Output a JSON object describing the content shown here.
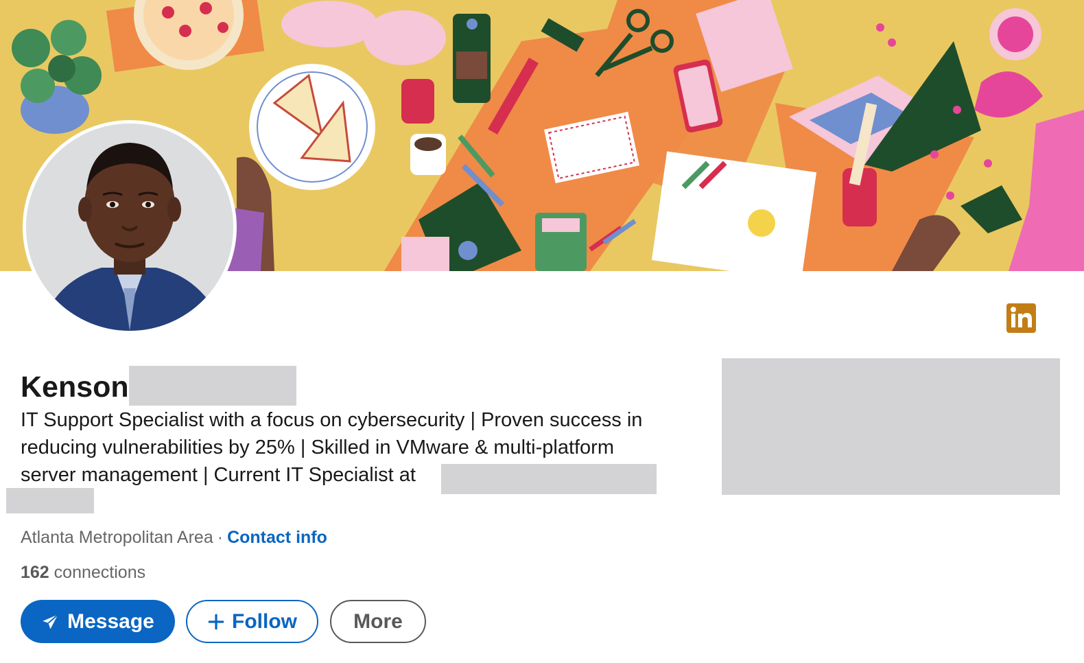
{
  "profile": {
    "name_visible": "Kenson",
    "headline_line1": "IT Support Specialist with a focus on cybersecurity | Proven success in",
    "headline_line2": "reducing vulnerabilities by 25% | Skilled in VMware & multi-platform",
    "headline_line3": "server management | Current IT Specialist at",
    "location": "Atlanta Metropolitan Area",
    "separator": "·",
    "contact_info_label": "Contact info",
    "connections_count": "162",
    "connections_label": "connections"
  },
  "actions": {
    "message_label": "Message",
    "follow_label": "Follow",
    "more_label": "More"
  },
  "icons": {
    "linkedin_badge": "linkedin-icon",
    "message": "paper-plane-icon",
    "follow": "plus-icon"
  },
  "colors": {
    "brand_blue": "#0a66c2",
    "badge_gold": "#c37d16",
    "redaction": "#d3d3d5",
    "banner_yellow": "#e9c862",
    "banner_orange": "#f08a47"
  }
}
